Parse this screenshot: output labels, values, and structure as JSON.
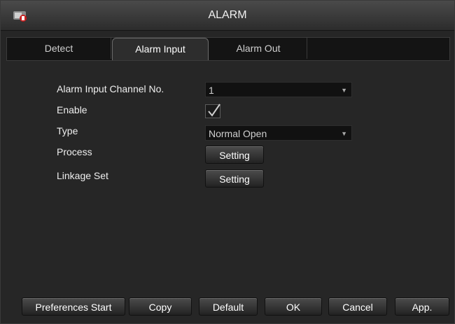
{
  "window": {
    "title": "ALARM"
  },
  "tabs": [
    {
      "label": "Detect",
      "active": false
    },
    {
      "label": "Alarm Input",
      "active": true
    },
    {
      "label": "Alarm Out",
      "active": false
    }
  ],
  "form": {
    "channel": {
      "label": "Alarm Input Channel No.",
      "value": "1"
    },
    "enable": {
      "label": "Enable",
      "checked": true
    },
    "type": {
      "label": "Type",
      "value": "Normal Open"
    },
    "process": {
      "label": "Process",
      "button": "Setting"
    },
    "linkage": {
      "label": "Linkage Set",
      "button": "Setting"
    }
  },
  "footer": {
    "preferences": "Preferences Start",
    "copy": "Copy",
    "default": "Default",
    "ok": "OK",
    "cancel": "Cancel",
    "apply": "App."
  },
  "icons": {
    "app": "camera-alarm-icon",
    "dropdown": "chevron-down-icon",
    "check": "checkmark-icon"
  }
}
